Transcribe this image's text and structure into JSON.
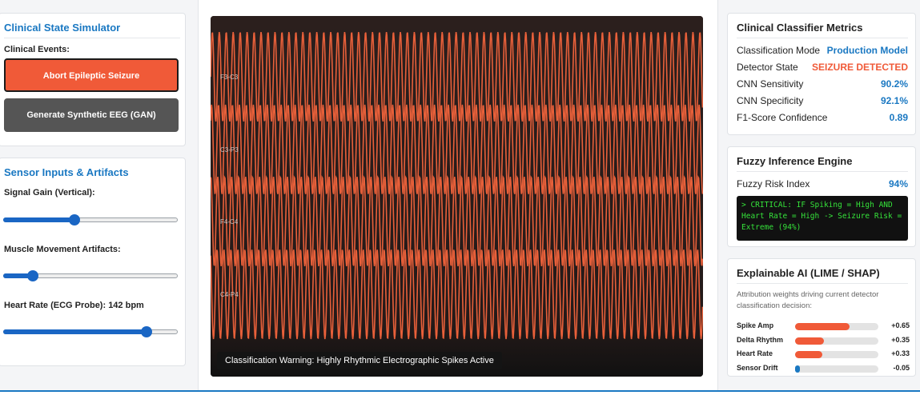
{
  "simulator": {
    "title": "Clinical State Simulator",
    "events_label": "Clinical Events:",
    "abort_button": "Abort Epileptic Seizure",
    "gan_button": "Generate Synthetic EEG (GAN)"
  },
  "sensors": {
    "title": "Sensor Inputs & Artifacts",
    "gain_label": "Signal Gain (Vertical):",
    "gain_value": 0.41,
    "muscle_label": "Muscle Movement Artifacts:",
    "muscle_value": 0.17,
    "hr_label": "Heart Rate (ECG Probe): 142 bpm",
    "hr_value": 0.82
  },
  "eeg": {
    "channels": [
      "F3-C3",
      "C3-P3",
      "F4-C4",
      "C4-P4"
    ],
    "warning": "Classification Warning: Highly Rhythmic Electrographic Spikes Active",
    "trace_color": "#e8603a"
  },
  "metrics": {
    "title": "Clinical Classifier Metrics",
    "rows": [
      {
        "label": "Classification Mode",
        "value": "Production Model",
        "color": "#1a78c2"
      },
      {
        "label": "Detector State",
        "value": "SEIZURE DETECTED",
        "color": "#f05a38"
      },
      {
        "label": "CNN Sensitivity",
        "value": "90.2%",
        "color": "#1a78c2"
      },
      {
        "label": "CNN Specificity",
        "value": "92.1%",
        "color": "#1a78c2"
      },
      {
        "label": "F1-Score Confidence",
        "value": "0.89",
        "color": "#1a78c2"
      }
    ]
  },
  "fuzzy": {
    "title": "Fuzzy Inference Engine",
    "risk_label": "Fuzzy Risk Index",
    "risk_value": "94%",
    "console": "> CRITICAL: IF Spiking = High AND Heart Rate = High -> Seizure Risk = Extreme (94%)"
  },
  "xai": {
    "title": "Explainable AI (LIME / SHAP)",
    "description": "Attribution weights driving current detector classification decision:",
    "features": [
      {
        "name": "Spike Amp",
        "value": "+0.65",
        "weight": 0.65,
        "color": "#f05a38"
      },
      {
        "name": "Delta Rhythm",
        "value": "+0.35",
        "weight": 0.35,
        "color": "#f05a38"
      },
      {
        "name": "Heart Rate",
        "value": "+0.33",
        "weight": 0.33,
        "color": "#f05a38"
      },
      {
        "name": "Sensor Drift",
        "value": "-0.05",
        "weight": 0.05,
        "color": "#1a78c2"
      }
    ]
  }
}
